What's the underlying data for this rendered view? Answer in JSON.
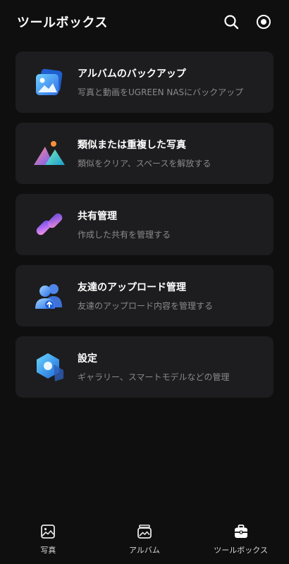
{
  "header": {
    "title": "ツールボックス",
    "icons": [
      "search-icon",
      "target-icon"
    ]
  },
  "cards": [
    {
      "title": "アルバムのバックアップ",
      "subtitle": "写真と動画をUGREEN NASにバックアップ",
      "icon": "photo-backup-icon"
    },
    {
      "title": "類似または重複した写真",
      "subtitle": "類似をクリア、スペースを解放する",
      "icon": "duplicate-photos-icon"
    },
    {
      "title": "共有管理",
      "subtitle": "作成した共有を管理する",
      "icon": "link-icon"
    },
    {
      "title": "友達のアップロード管理",
      "subtitle": "友達のアップロード内容を管理する",
      "icon": "friends-upload-icon"
    },
    {
      "title": "設定",
      "subtitle": "ギャラリー、スマートモデルなどの管理",
      "icon": "settings-hexagon-icon"
    }
  ],
  "bottom_nav": [
    {
      "label": "写真",
      "icon": "photo-icon"
    },
    {
      "label": "アルバム",
      "icon": "album-icon"
    },
    {
      "label": "ツールボックス",
      "icon": "toolbox-icon"
    }
  ],
  "colors": {
    "background": "#0f0f10",
    "card": "#1d1d1f",
    "subtitle": "#8a8a8e",
    "accent_blue": "#3b82f6",
    "accent_purple": "#a06bf0"
  }
}
